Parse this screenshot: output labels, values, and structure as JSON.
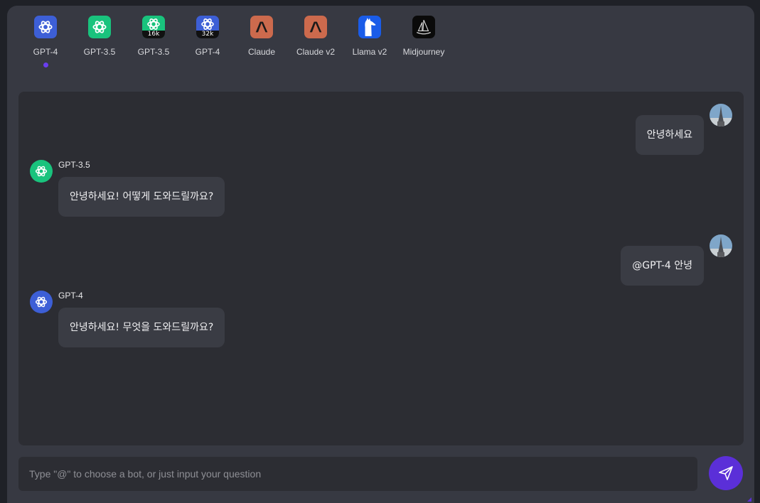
{
  "bots": [
    {
      "label": "GPT-4",
      "icon": "openai-icon",
      "bg": "#3d5fd6",
      "badge": "",
      "active": true
    },
    {
      "label": "GPT-3.5",
      "icon": "openai-icon",
      "bg": "#19c37d",
      "badge": "",
      "active": false
    },
    {
      "label": "GPT-3.5",
      "icon": "openai-icon",
      "bg": "#19c37d",
      "badge": "16k",
      "active": false
    },
    {
      "label": "GPT-4",
      "icon": "openai-icon",
      "bg": "#3d5fd6",
      "badge": "32k",
      "active": false
    },
    {
      "label": "Claude",
      "icon": "anthropic-icon",
      "bg": "#cc6a4d",
      "badge": "",
      "active": false
    },
    {
      "label": "Claude v2",
      "icon": "anthropic-icon",
      "bg": "#cc6a4d",
      "badge": "",
      "active": false
    },
    {
      "label": "Llama v2",
      "icon": "llama-icon",
      "bg": "#1a5ce8",
      "badge": "",
      "active": false
    },
    {
      "label": "Midjourney",
      "icon": "midjourney-icon",
      "bg": "#0a0a0a",
      "badge": "",
      "active": false
    }
  ],
  "messages": [
    {
      "role": "user",
      "text": "안녕하세요"
    },
    {
      "role": "bot",
      "name": "GPT-3.5",
      "icon": "openai-icon",
      "color": "#19c37d",
      "text": "안녕하세요! 어떻게 도와드릴까요?"
    },
    {
      "role": "user",
      "text": "@GPT-4 안녕"
    },
    {
      "role": "bot",
      "name": "GPT-4",
      "icon": "openai-icon",
      "color": "#3d5fd6",
      "text": "안녕하세요! 무엇을 도와드릴까요?"
    }
  ],
  "input": {
    "placeholder": "Type \"@\" to choose a bot, or just input your question",
    "value": ""
  },
  "colors": {
    "accent": "#5b2fd8",
    "panel": "#373942",
    "chat_bg": "#2c2d33",
    "bubble": "#3a3c44"
  }
}
